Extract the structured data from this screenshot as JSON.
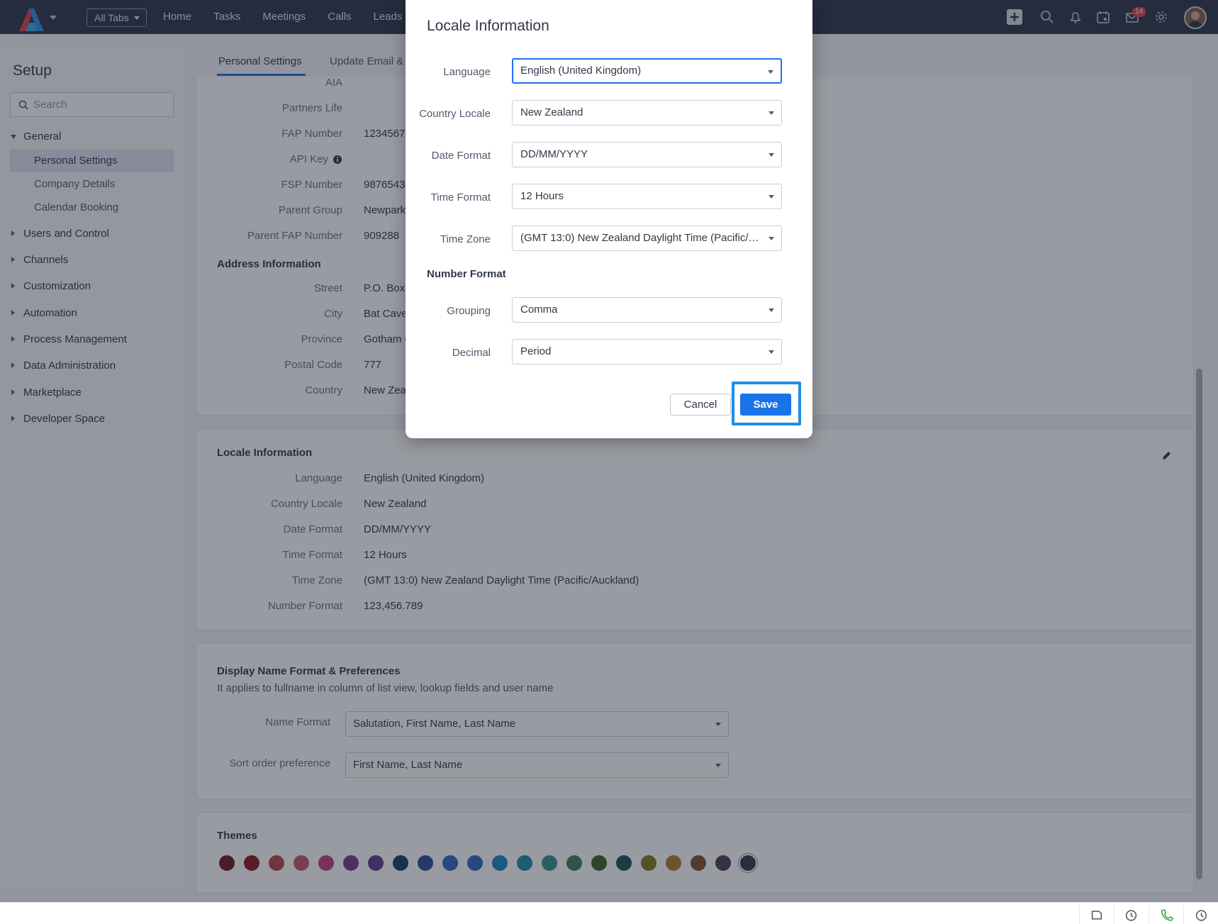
{
  "nav": {
    "all_tabs": "All Tabs",
    "links": [
      "Home",
      "Tasks",
      "Meetings",
      "Calls",
      "Leads"
    ],
    "mail_badge": "14"
  },
  "sidebar": {
    "title": "Setup",
    "search_placeholder": "Search",
    "general": "General",
    "general_items": [
      "Personal Settings",
      "Company Details",
      "Calendar Booking"
    ],
    "sections": [
      "Users and Control",
      "Channels",
      "Customization",
      "Automation",
      "Process Management",
      "Data Administration",
      "Marketplace",
      "Developer Space"
    ]
  },
  "tabs": {
    "personal_settings": "Personal Settings",
    "update_email": "Update Email &"
  },
  "profile": {
    "rows": [
      {
        "label": "AIA",
        "value": ""
      },
      {
        "label": "Partners Life",
        "value": ""
      },
      {
        "label": "FAP Number",
        "value": "1234567"
      },
      {
        "label": "API Key",
        "value": ""
      },
      {
        "label": "FSP Number",
        "value": "9876543"
      },
      {
        "label": "Parent Group",
        "value": "Newpark"
      },
      {
        "label": "Parent FAP Number",
        "value": "909288"
      }
    ],
    "address_title": "Address Information",
    "address_rows": [
      {
        "label": "Street",
        "value": "P.O. Box"
      },
      {
        "label": "City",
        "value": "Bat Cave"
      },
      {
        "label": "Province",
        "value": "Gotham C"
      },
      {
        "label": "Postal Code",
        "value": "777"
      },
      {
        "label": "Country",
        "value": "New Zeal"
      }
    ]
  },
  "locale_card": {
    "title": "Locale Information",
    "rows": [
      {
        "label": "Language",
        "value": "English (United Kingdom)"
      },
      {
        "label": "Country Locale",
        "value": "New Zealand"
      },
      {
        "label": "Date Format",
        "value": "DD/MM/YYYY"
      },
      {
        "label": "Time Format",
        "value": "12 Hours"
      },
      {
        "label": "Time Zone",
        "value": "(GMT 13:0) New Zealand Daylight Time (Pacific/Auckland)"
      },
      {
        "label": "Number Format",
        "value": "123,456.789"
      }
    ]
  },
  "display_name": {
    "title": "Display Name Format & Preferences",
    "subtitle": "It applies to fullname in column of list view, lookup fields and user name",
    "name_format_label": "Name Format",
    "name_format_value": "Salutation, First Name, Last Name",
    "sort_label": "Sort order preference",
    "sort_value": "First Name, Last Name"
  },
  "themes": {
    "title": "Themes",
    "colors": [
      "#6d1a20",
      "#8c1b22",
      "#b5474c",
      "#c35a69",
      "#c2437a",
      "#7b3a8f",
      "#5e3c8f",
      "#1d3b6b",
      "#2a4f8f",
      "#3264c0",
      "#2f68c2",
      "#1b87c5",
      "#1a8fa6",
      "#3a8f8f",
      "#3e7e55",
      "#3f6222",
      "#1e4f58",
      "#7c7b1d",
      "#b07b2a",
      "#7a5332",
      "#4e3e56",
      "#2f3a4f"
    ]
  },
  "modal": {
    "title": "Locale Information",
    "language_label": "Language",
    "language_value": "English (United Kingdom)",
    "country_label": "Country Locale",
    "country_value": "New Zealand",
    "date_label": "Date Format",
    "date_value": "DD/MM/YYYY",
    "time_label": "Time Format",
    "time_value": "12 Hours",
    "tz_label": "Time Zone",
    "tz_value": "(GMT 13:0) New Zealand Daylight Time (Pacific/Au...",
    "number_format_title": "Number Format",
    "grouping_label": "Grouping",
    "grouping_value": "Comma",
    "decimal_label": "Decimal",
    "decimal_value": "Period",
    "cancel": "Cancel",
    "save": "Save"
  }
}
